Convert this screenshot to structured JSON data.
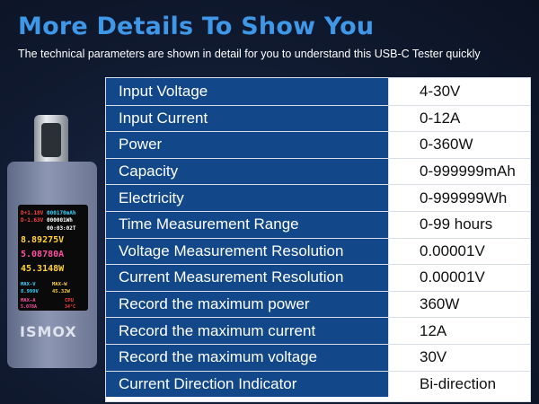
{
  "header": {
    "title": "More Details To Show You",
    "subtitle": "The technical parameters are shown in detail for you to understand this USB-C Tester quickly"
  },
  "specs": [
    {
      "param": "Input Voltage",
      "value": "4-30V"
    },
    {
      "param": "Input Current",
      "value": "0-12A"
    },
    {
      "param": "Power",
      "value": "0-360W"
    },
    {
      "param": "Capacity",
      "value": "0-999999mAh"
    },
    {
      "param": "Electricity",
      "value": "0-999999Wh"
    },
    {
      "param": "Time Measurement Range",
      "value": "0-99 hours"
    },
    {
      "param": "Voltage Measurement Resolution",
      "value": "0.00001V"
    },
    {
      "param": "Current Measurement Resolution",
      "value": "0.00001V"
    },
    {
      "param": "Record the maximum power",
      "value": "360W"
    },
    {
      "param": "Record the maximum current",
      "value": "12A"
    },
    {
      "param": "Record the maximum voltage",
      "value": "30V"
    },
    {
      "param": "Current Direction Indicator",
      "value": "Bi-direction"
    }
  ],
  "device": {
    "logo": "ISMOX",
    "screen": {
      "voltage": "8.89275V",
      "current": "5.08780A",
      "power": "45.3148W",
      "dp": "D+1.18V",
      "dm": "D-1.63V",
      "capacity": "000170mAh",
      "energy": "000001Wh",
      "time": "00:03:02T",
      "max_v_label": "MAX-V",
      "max_v": "8.999V",
      "max_w_label": "MAX-W",
      "max_w": "45.32W",
      "max_a_label": "MAX-A",
      "max_a": "5.078A",
      "cpu_label": "CPU",
      "cpu_temp": "34°C"
    }
  },
  "colors": {
    "title": "#3f97e8",
    "param_cell": "#12488a",
    "value_cell": "#ffffff"
  }
}
